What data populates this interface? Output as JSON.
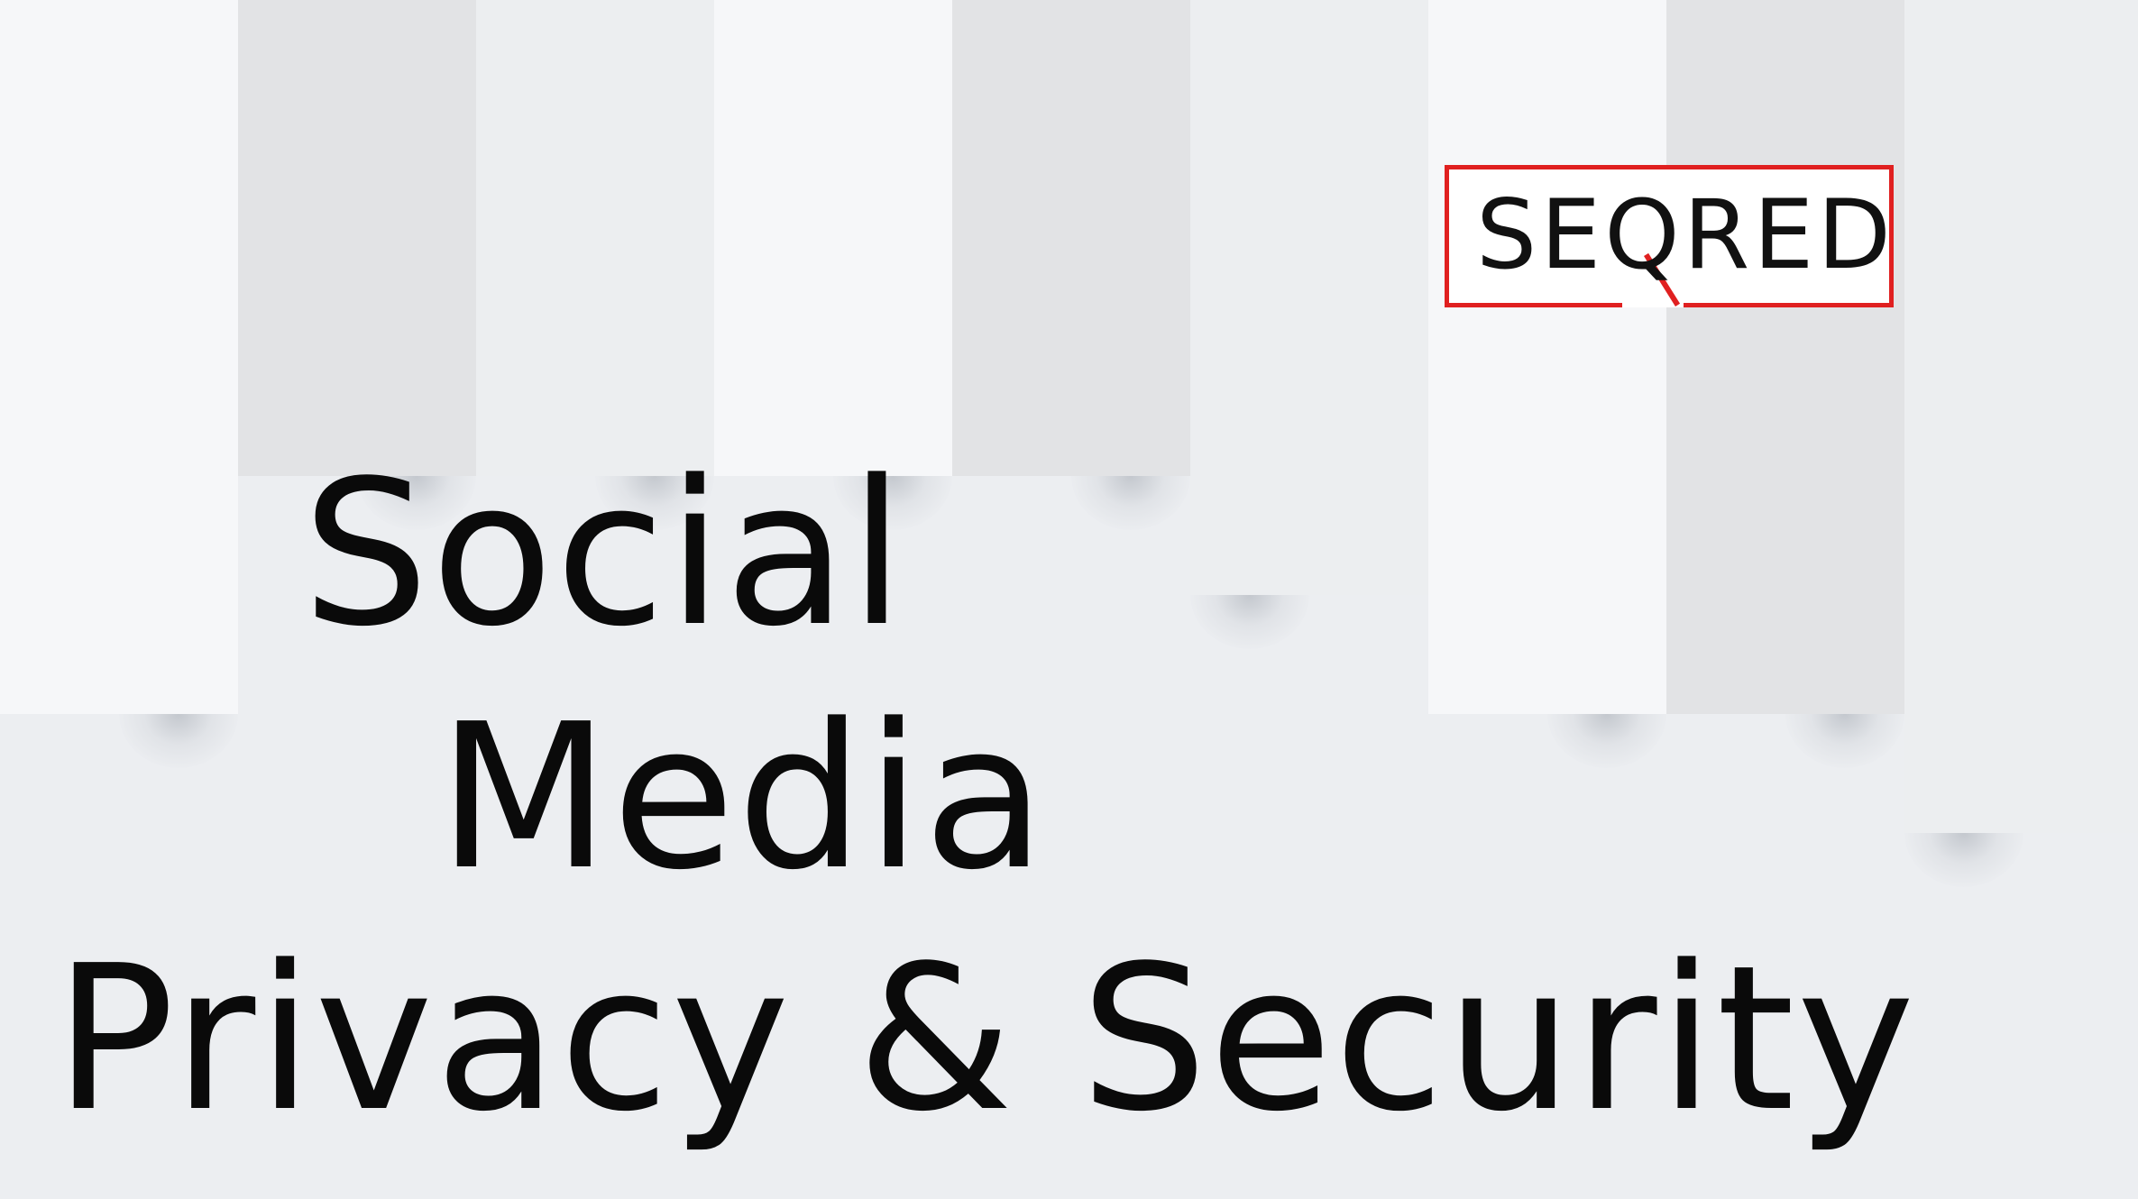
{
  "logo": {
    "text": "SEQRED",
    "border_color": "#e02020"
  },
  "title": {
    "line1": "Social",
    "line2": "Media",
    "line3": "Privacy & Security"
  },
  "colors": {
    "background": "#eceef1",
    "text": "#0a0a0a"
  }
}
